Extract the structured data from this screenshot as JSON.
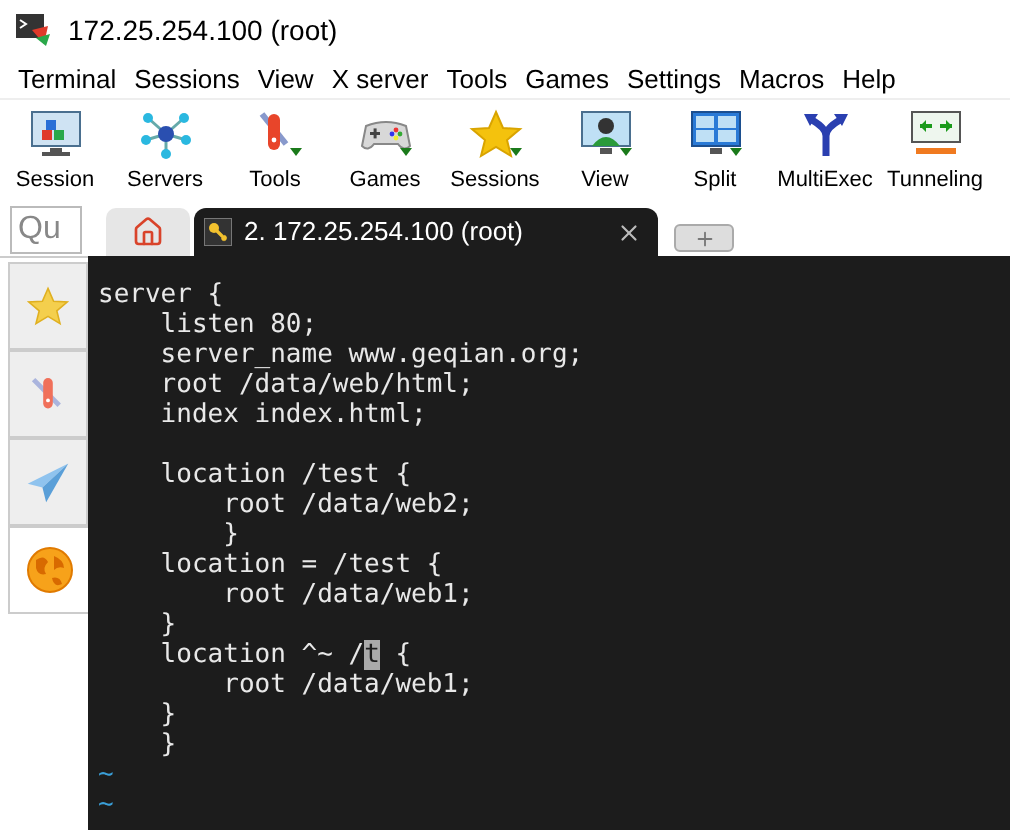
{
  "window": {
    "title": "172.25.254.100 (root)"
  },
  "menu": [
    "Terminal",
    "Sessions",
    "View",
    "X server",
    "Tools",
    "Games",
    "Settings",
    "Macros",
    "Help"
  ],
  "toolbar": [
    {
      "label": "Session",
      "kind": "session"
    },
    {
      "label": "Servers",
      "kind": "servers"
    },
    {
      "label": "Tools",
      "kind": "tools"
    },
    {
      "label": "Games",
      "kind": "games"
    },
    {
      "label": "Sessions",
      "kind": "sessions"
    },
    {
      "label": "View",
      "kind": "view"
    },
    {
      "label": "Split",
      "kind": "split"
    },
    {
      "label": "MultiExec",
      "kind": "multiexec"
    },
    {
      "label": "Tunneling",
      "kind": "tunneling"
    }
  ],
  "quick_connect": {
    "placeholder": "Qu"
  },
  "tabs": [
    {
      "kind": "home",
      "selected": false
    },
    {
      "kind": "session",
      "label": "2. 172.25.254.100 (root)",
      "selected": true
    }
  ],
  "side_tabs": [
    {
      "kind": "star",
      "selected": false
    },
    {
      "kind": "tools",
      "selected": false
    },
    {
      "kind": "plane",
      "selected": false
    },
    {
      "kind": "globe",
      "selected": true
    }
  ],
  "terminal": {
    "lines": [
      {
        "kind": "code",
        "text": "server {"
      },
      {
        "kind": "code",
        "text": "    listen 80;"
      },
      {
        "kind": "code",
        "text": "    server_name www.geqian.org;"
      },
      {
        "kind": "code",
        "text": "    root /data/web/html;"
      },
      {
        "kind": "code",
        "text": "    index index.html;"
      },
      {
        "kind": "blank"
      },
      {
        "kind": "code",
        "text": "    location /test {"
      },
      {
        "kind": "code",
        "text": "        root /data/web2;"
      },
      {
        "kind": "code",
        "text": "        }"
      },
      {
        "kind": "code",
        "text": "    location = /test {"
      },
      {
        "kind": "code",
        "text": "        root /data/web1;"
      },
      {
        "kind": "code",
        "text": "    }"
      },
      {
        "kind": "cursor",
        "text": "    location ^~ /",
        "cursor": "t",
        "after": " {"
      },
      {
        "kind": "code",
        "text": "        root /data/web1;"
      },
      {
        "kind": "code",
        "text": "    }"
      },
      {
        "kind": "code",
        "text": "    }"
      },
      {
        "kind": "tilde",
        "text": "~"
      },
      {
        "kind": "tilde",
        "text": "~"
      }
    ]
  }
}
